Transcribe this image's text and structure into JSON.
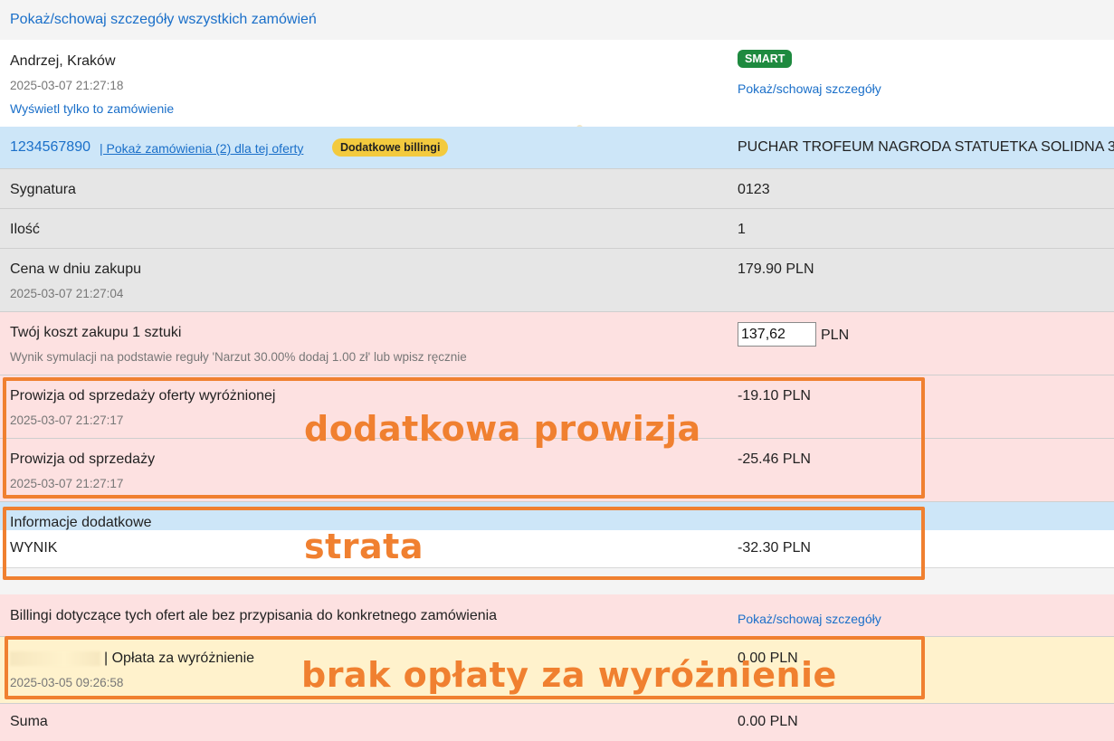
{
  "top_link": "Pokaż/schowaj szczegóły wszystkich zamówień",
  "order": {
    "buyer": "Andrzej, Kraków",
    "datetime": "2025-03-07 21:27:18",
    "only_this_link": "Wyświetl tylko to zamówienie",
    "badge": "SMART",
    "details_link": "Pokaż/schowaj szczegóły"
  },
  "offer": {
    "id": "1234567890",
    "orders_link": "| Pokaż zamówienia (2) dla tej oferty",
    "badge": "Dodatkowe billingi",
    "title": "PUCHAR TROFEUM NAGRODA STATUETKA SOLIDNA 3"
  },
  "rows": {
    "signature": {
      "label": "Sygnatura",
      "value": "0123"
    },
    "quantity": {
      "label": "Ilość",
      "value": "1"
    },
    "price": {
      "label": "Cena w dniu zakupu",
      "date": "2025-03-07 21:27:04",
      "value": "179.90 PLN"
    },
    "cost": {
      "label": "Twój koszt zakupu 1 sztuki",
      "note": "Wynik symulacji na podstawie reguły 'Narzut 30.00% dodaj 1.00 zł' lub wpisz ręcznie",
      "input_value": "137,62",
      "unit": "PLN"
    },
    "commission_featured": {
      "label": "Prowizja od sprzedaży oferty wyróżnionej",
      "date": "2025-03-07 21:27:17",
      "value": "-19.10 PLN"
    },
    "commission": {
      "label": "Prowizja od sprzedaży",
      "date": "2025-03-07 21:27:17",
      "value": "-25.46 PLN"
    }
  },
  "additional_info": "Informacje dodatkowe",
  "result": {
    "label": "WYNIK",
    "value": "-32.30 PLN"
  },
  "billings": {
    "title": "Billingi dotyczące tych ofert ale bez przypisania do konkretnego zamówienia",
    "details_link": "Pokaż/schowaj szczegóły",
    "fee_label": "| Opłata za wyróżnienie",
    "fee_date": "2025-03-05 09:26:58",
    "fee_value": "0.00 PLN",
    "sum_label": "Suma",
    "sum_value": "0.00 PLN"
  },
  "annotations": {
    "extra_commission": "dodatkowa prowizja",
    "loss": "strata",
    "no_fee": "brak opłaty za wyróżnienie",
    "color": "#f08030"
  },
  "colors": {
    "link": "#1a6fc9",
    "smart_badge": "#1e8a3f",
    "billing_badge": "#f3ca3e",
    "pink_row": "#fde1e1",
    "blue_row": "#cde6f8",
    "gray_row": "#e6e6e6",
    "yellow_row": "#fff2cc"
  }
}
